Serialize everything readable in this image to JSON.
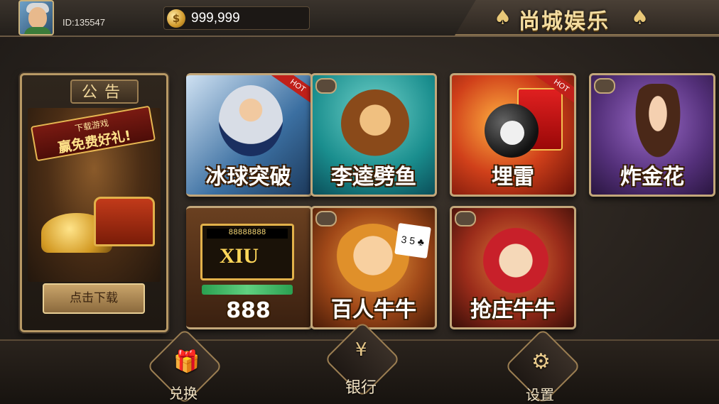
{
  "header": {
    "user_id": "ID:135547",
    "coin_balance": "999,999",
    "coin_symbol": "$",
    "brand_title": "尚城娱乐",
    "brand_icon_left": "spade-icon",
    "brand_icon_right": "spade-icon"
  },
  "notice": {
    "title": "公告",
    "banner_line1": "下载游戏",
    "banner_line2": "赢免费好礼!",
    "download_button": "点击下载"
  },
  "games": [
    {
      "label": "冰球突破",
      "badge": "HOT"
    },
    {
      "label": "李逵劈鱼",
      "badge": ""
    },
    {
      "label": "埋雷",
      "badge": "HOT"
    },
    {
      "label": "炸金花",
      "badge": ""
    },
    {
      "label": "888",
      "badge": "",
      "slot_digits": "88888888",
      "slot_reel": "XIU"
    },
    {
      "label": "百人牛牛",
      "badge": "",
      "card_text": "3 5 ♣"
    },
    {
      "label": "抢庄牛牛",
      "badge": ""
    }
  ],
  "bottom_nav": {
    "exchange": "兑换",
    "bank": "银行",
    "bank_symbol": "¥",
    "settings": "设置"
  },
  "colors": {
    "accent_gold": "#c3a77a",
    "brand_text": "#f3dca0",
    "hot_badge": "#c0201a"
  }
}
